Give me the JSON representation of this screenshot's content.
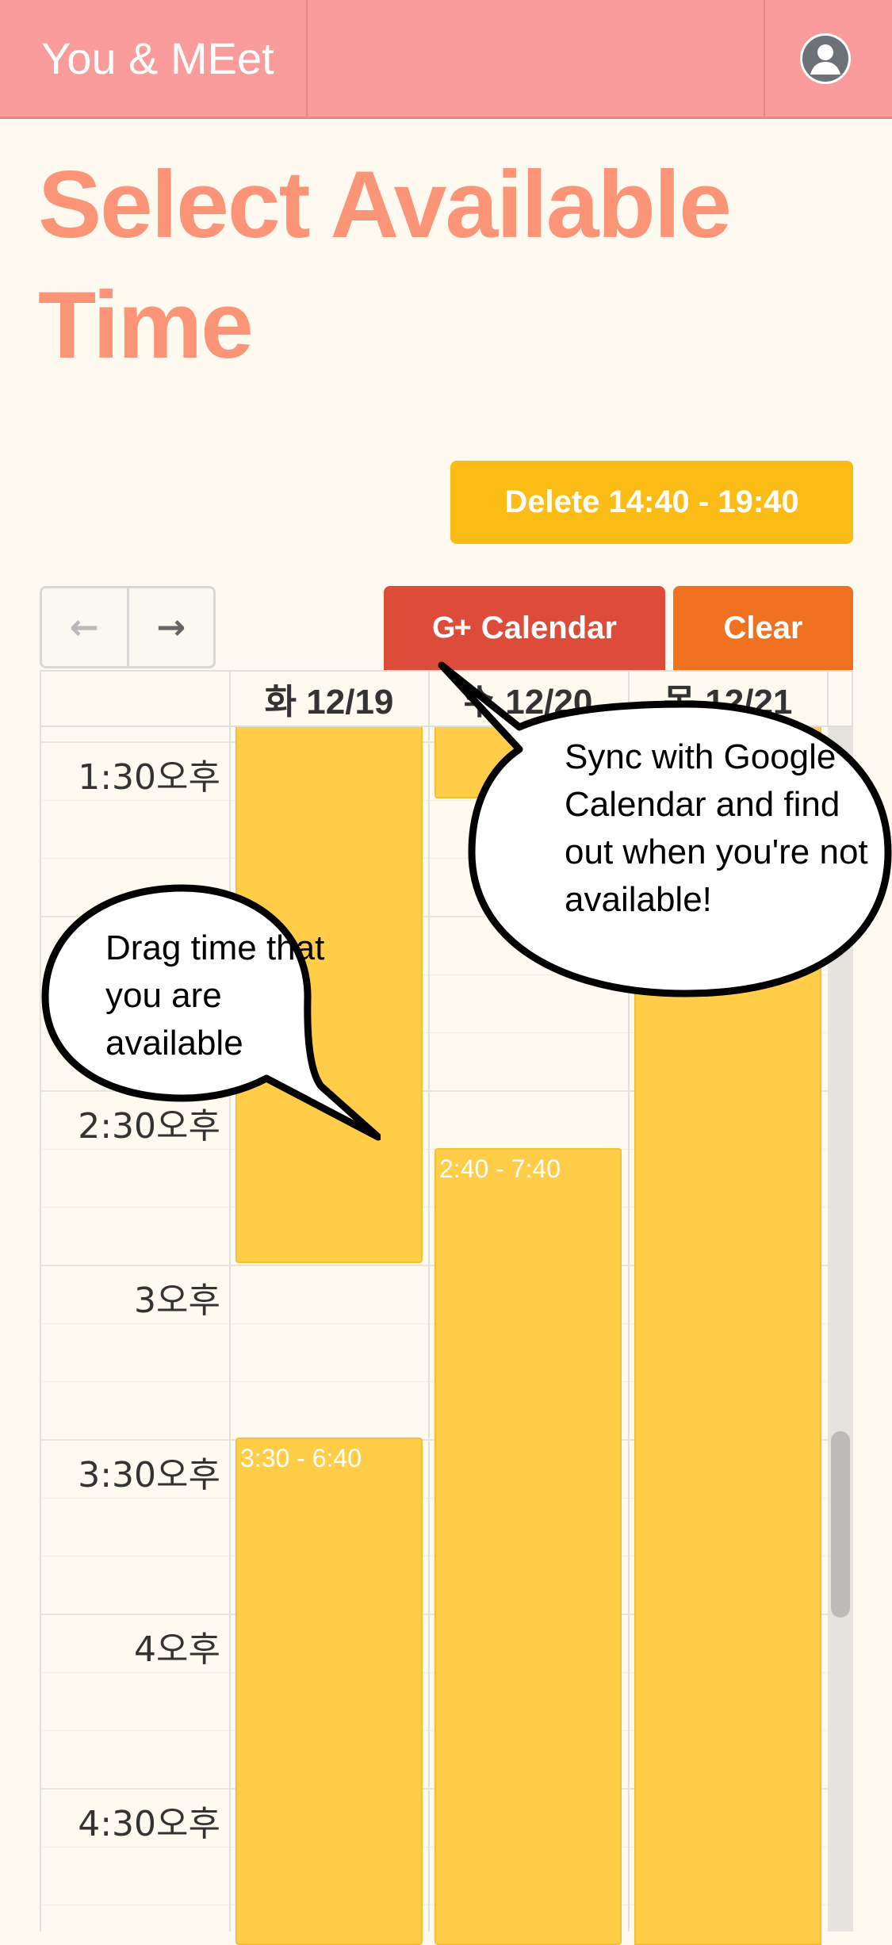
{
  "header": {
    "brand": "You & MEet",
    "avatar_icon": "user-avatar-icon"
  },
  "page": {
    "title": "Select Available Time"
  },
  "actions": {
    "delete_label": "Delete 14:40 - 19:40",
    "gcal_plus": "G+",
    "gcal_label": "Calendar",
    "clear_label": "Clear",
    "prev_icon": "arrow-left-icon",
    "next_icon": "arrow-right-icon"
  },
  "calendar": {
    "days": [
      "화 12/19",
      "수 12/20",
      "목 12/21"
    ],
    "times": [
      "1:30오후",
      "2:30오후",
      "3오후",
      "3:30오후",
      "4오후",
      "4:30오후"
    ],
    "events": [
      {
        "day": 0,
        "label": ""
      },
      {
        "day": 0,
        "label": "3:30 - 6:40"
      },
      {
        "day": 1,
        "label": ""
      },
      {
        "day": 1,
        "label": "2:40 - 7:40"
      },
      {
        "day": 2,
        "label": ""
      }
    ]
  },
  "tips": {
    "drag": "Drag time that you are available",
    "sync": "Sync with Google Calendar and find out when you're not available!"
  },
  "colors": {
    "header_bg": "#f99c9b",
    "title": "#fc9478",
    "delete": "#fbbd15",
    "google": "#dd4b39",
    "clear": "#f07221",
    "event": "#ffcd48",
    "page_bg": "#fffaf0"
  }
}
